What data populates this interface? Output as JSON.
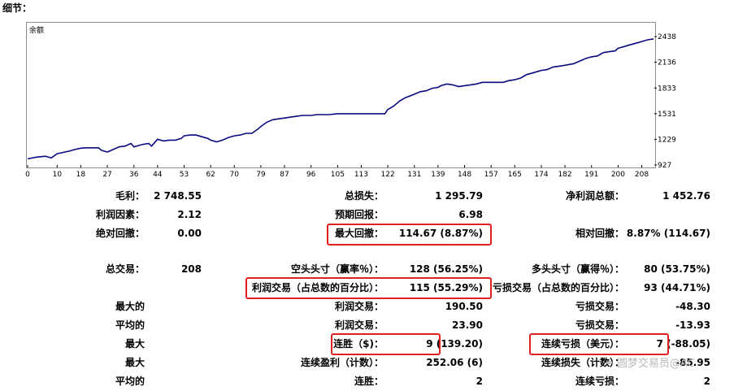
{
  "header": {
    "title": "细节："
  },
  "chart_data": {
    "type": "line",
    "title": "余额",
    "xlabel": "",
    "ylabel": "",
    "x_ticks": [
      "0",
      "10",
      "18",
      "27",
      "36",
      "44",
      "53",
      "62",
      "70",
      "79",
      "87",
      "96",
      "105",
      "113",
      "122",
      "131",
      "139",
      "148",
      "157",
      "165",
      "174",
      "182",
      "191",
      "200",
      "208"
    ],
    "y_ticks": [
      "2438",
      "2136",
      "1833",
      "1531",
      "1229",
      "927"
    ],
    "xlim": [
      0,
      212
    ],
    "ylim": [
      927,
      2438
    ],
    "line_color": "#0a0a80",
    "x": [
      0,
      3,
      6,
      8,
      10,
      12,
      14,
      16,
      18,
      20,
      22,
      24,
      25,
      27,
      29,
      31,
      33,
      35,
      36,
      38,
      39,
      41,
      42,
      44,
      46,
      48,
      50,
      52,
      53,
      55,
      57,
      59,
      61,
      62,
      64,
      66,
      68,
      70,
      72,
      74,
      76,
      78,
      79,
      81,
      83,
      85,
      87,
      89,
      91,
      93,
      96,
      98,
      100,
      102,
      105,
      107,
      109,
      111,
      113,
      115,
      117,
      119,
      121,
      122,
      124,
      126,
      128,
      131,
      133,
      135,
      137,
      139,
      140,
      142,
      144,
      146,
      148,
      150,
      152,
      154,
      156,
      157,
      159,
      161,
      163,
      165,
      167,
      169,
      171,
      173,
      174,
      176,
      178,
      180,
      182,
      185,
      187,
      189,
      191,
      193,
      195,
      197,
      199,
      200,
      202,
      204,
      206,
      208,
      210,
      212
    ],
    "y": [
      1000,
      1020,
      1030,
      1010,
      1060,
      1075,
      1090,
      1110,
      1125,
      1130,
      1130,
      1130,
      1100,
      1080,
      1110,
      1140,
      1150,
      1180,
      1140,
      1160,
      1170,
      1180,
      1150,
      1230,
      1210,
      1220,
      1220,
      1240,
      1270,
      1280,
      1280,
      1260,
      1240,
      1220,
      1200,
      1220,
      1250,
      1270,
      1280,
      1300,
      1300,
      1350,
      1380,
      1430,
      1460,
      1470,
      1480,
      1490,
      1500,
      1510,
      1510,
      1520,
      1520,
      1520,
      1530,
      1530,
      1530,
      1530,
      1530,
      1530,
      1530,
      1530,
      1530,
      1580,
      1620,
      1680,
      1720,
      1760,
      1790,
      1800,
      1830,
      1840,
      1860,
      1880,
      1870,
      1850,
      1860,
      1870,
      1880,
      1900,
      1900,
      1900,
      1900,
      1900,
      1920,
      1930,
      1950,
      1990,
      2010,
      2030,
      2040,
      2050,
      2080,
      2090,
      2100,
      2120,
      2150,
      2180,
      2200,
      2210,
      2250,
      2260,
      2270,
      2300,
      2320,
      2340,
      2360,
      2380,
      2400,
      2410
    ]
  },
  "stats": {
    "col1": [
      {
        "label": "毛利：",
        "value": "2 748.55"
      },
      {
        "label": "利润因素：",
        "value": "2.12"
      },
      {
        "label": "绝对回撤：",
        "value": "0.00"
      },
      {
        "label": "总交易：",
        "value": "208"
      },
      {
        "label": "最大的",
        "value": ""
      },
      {
        "label": "平均的",
        "value": ""
      },
      {
        "label": "最大",
        "value": ""
      },
      {
        "label": "最大",
        "value": ""
      },
      {
        "label": "平均的",
        "value": ""
      }
    ],
    "col2": [
      {
        "label": "总损失：",
        "value": "1 295.79"
      },
      {
        "label": "预期回报：",
        "value": "6.98"
      },
      {
        "label": "最大回撤：",
        "value": "114.67 (8.87%)"
      },
      {
        "label": "空头头寸（赢率％）：",
        "value": "128 (56.25%)"
      },
      {
        "label": "利润交易（占总数的百分比）：",
        "value": "115 (55.29%)"
      },
      {
        "label": "利润交易：",
        "value": "190.50"
      },
      {
        "label": "利润交易：",
        "value": "23.90"
      },
      {
        "label": "连胜（$)：",
        "value": "9 (139.20)"
      },
      {
        "label": "连续盈利（计数）：",
        "value": "252.06 (6)"
      },
      {
        "label": "连胜：",
        "value": "2"
      }
    ],
    "col3": [
      {
        "label": "净利润总额：",
        "value": "1 452.76"
      },
      {
        "label": "相对回撤：",
        "value": "8.87% (114.67)"
      },
      {
        "label": "多头头寸（赢得％）：",
        "value": "80 (53.75%)"
      },
      {
        "label": "亏损交易（占总数的百分比）：",
        "value": "93 (44.71%)"
      },
      {
        "label": "亏损交易：",
        "value": "-48.30"
      },
      {
        "label": "亏损交易：",
        "value": "-13.93"
      },
      {
        "label": "连续亏损（美元）：",
        "value": "7 (-88.05)"
      },
      {
        "label": "连续损失（计数）：",
        "value": "-85.95"
      },
      {
        "label": "连续亏损：",
        "value": "2"
      }
    ]
  },
  "watermark": {
    "icon": "feather-icon",
    "text": "圆梦交易员@AC"
  },
  "colors": {
    "highlight": "#e02020",
    "line": "#0a0a80"
  }
}
